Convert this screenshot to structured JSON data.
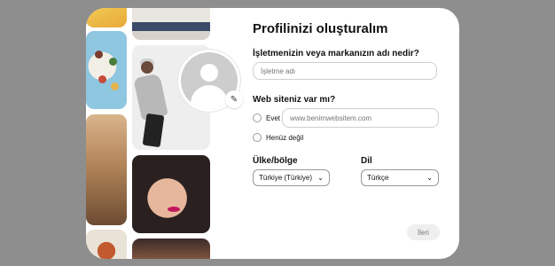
{
  "form": {
    "title": "Profilinizi oluşturalım",
    "business_question": "İşletmenizin veya markanızın adı nedir?",
    "business_placeholder": "İşletme adı",
    "website_question": "Web siteniz var mı?",
    "website_yes_label": "Evet",
    "website_placeholder": "www.benimwebsitem.com",
    "website_no_label": "Henüz değil",
    "country_label": "Ülke/bölge",
    "country_value": "Türkiye (Türkiye)",
    "language_label": "Dil",
    "language_value": "Türkçe",
    "next_button": "İleri"
  },
  "icons": {
    "avatar": "default-avatar-icon",
    "edit": "pencil-icon",
    "dropdown": "chevron-down-icon"
  },
  "colors": {
    "backdrop": "#8e8e8e",
    "next_button_bg": "#efefef",
    "avatar_bg": "#cdcdcd"
  }
}
